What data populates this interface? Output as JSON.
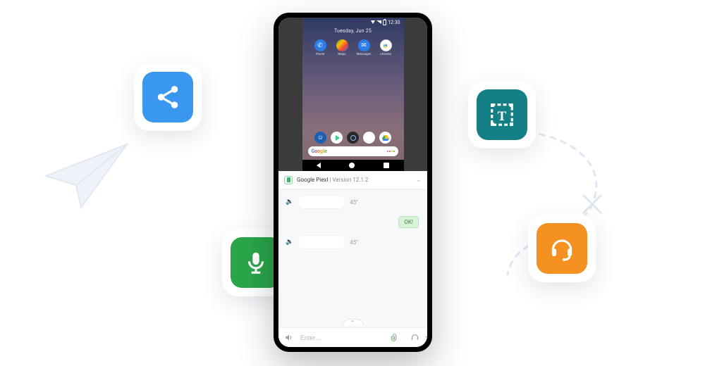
{
  "colors": {
    "blue": "#3a97f0",
    "teal": "#147f85",
    "green": "#2aa54a",
    "orange": "#f59121"
  },
  "android": {
    "time": "12:30",
    "date": "Tuesday, Jun 25",
    "top_apps": [
      {
        "name": "Phone"
      },
      {
        "name": "Maps"
      },
      {
        "name": "Messages"
      },
      {
        "name": "Chrome"
      }
    ],
    "dock_apps": [
      "Contacts",
      "Play",
      "Camera",
      "Calendar",
      "Drive"
    ],
    "search_logo": "Google"
  },
  "chat": {
    "device_name": "Google Piexl",
    "version_label": "Version 12.1.2",
    "separator": " | ",
    "messages": [
      {
        "type": "voice",
        "duration": "45''"
      },
      {
        "type": "reply",
        "text": "OK!"
      },
      {
        "type": "voice",
        "duration": "45''"
      }
    ],
    "input_placeholder": "Enter...",
    "expand_glyph": "⌃"
  },
  "tiles": {
    "share": "share-icon",
    "text_frame": "text-frame-icon",
    "mic": "mic-icon",
    "headset": "headset-icon"
  }
}
